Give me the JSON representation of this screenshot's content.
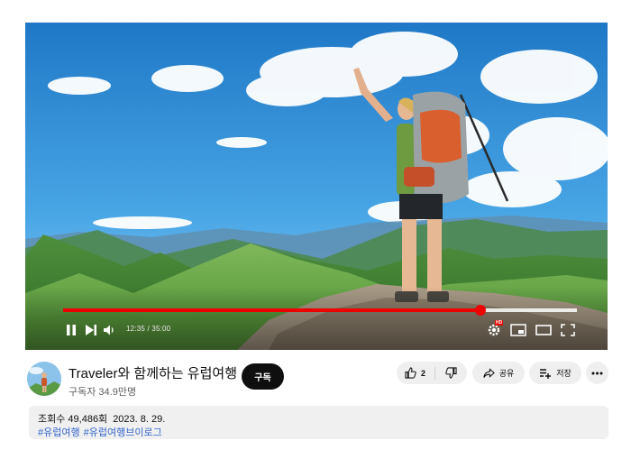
{
  "player": {
    "current_time": "12:35",
    "duration": "35:00",
    "time_separator": " / ",
    "progress": 0.812,
    "quality_badge": "HD",
    "scene_icon": "mountain-hiker-scene"
  },
  "channel": {
    "title": "Traveler와 함께하는 유럽여행",
    "subscribers": "구독자 34.9만명",
    "subscribe_label": "구독"
  },
  "actions": {
    "like_count": "2",
    "share_label": "공유",
    "save_label": "저장"
  },
  "description": {
    "views": "조회수 49,486회",
    "date": "2023. 8. 29.",
    "hashtags": [
      "#유럽여행",
      "#유럽여행브이로그"
    ]
  },
  "colors": {
    "accent": "#ee0000",
    "link": "#3366cc",
    "pill_bg": "#efefef",
    "button_dark": "#0f0f0f"
  }
}
